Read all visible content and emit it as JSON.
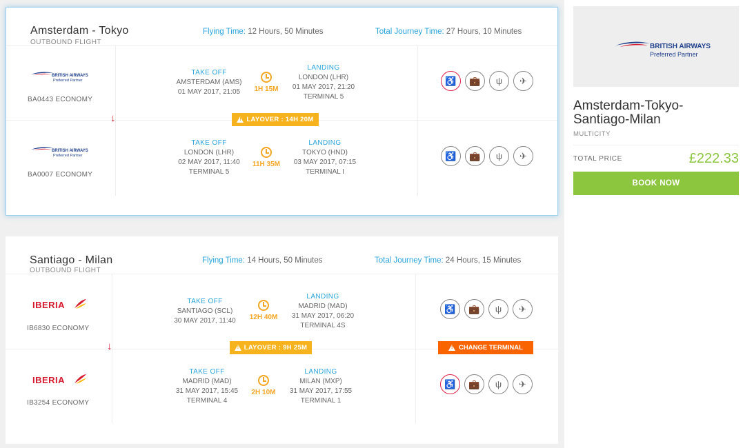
{
  "itineraries": [
    {
      "route": "Amsterdam - Tokyo",
      "subtitle": "OUTBOUND FLIGHT",
      "flying_label": "Flying Time:",
      "flying_value": " 12 Hours, 50 Minutes",
      "journey_label": "Total Journey Time:",
      "journey_value": " 27 Hours, 10 Minutes",
      "layover": "LAYOVER : 14H 20M",
      "segments": [
        {
          "airline": "BRITISH AIRWAYS",
          "airline_sub": "Preferred Partner",
          "code": "BA0443 ECONOMY",
          "takeoff_label": "TAKE OFF",
          "from": "AMSTERDAM (AMS)",
          "dep": "01 MAY 2017, 21:05",
          "duration": "1H 15M",
          "landing_label": "LANDING",
          "to": "LONDON (LHR)",
          "arr": "01 MAY 2017, 21:20",
          "terminal": "TERMINAL 5"
        },
        {
          "airline": "BRITISH AIRWAYS",
          "airline_sub": "Preferred Partner",
          "code": "BA0007 ECONOMY",
          "takeoff_label": "TAKE OFF",
          "from": "LONDON (LHR)",
          "dep": "02 MAY 2017, 11:40",
          "dep_terminal": "TERMINAL 5",
          "duration": "11H 35M",
          "landing_label": "LANDING",
          "to": "TOKYO (HND)",
          "arr": "03 MAY 2017, 07:15",
          "terminal": "TERMINAL I"
        }
      ]
    },
    {
      "route": "Santiago - Milan",
      "subtitle": "OUTBOUND FLIGHT",
      "flying_label": "Flying Time:",
      "flying_value": " 14 Hours, 50 Minutes",
      "journey_label": "Total Journey Time:",
      "journey_value": " 24 Hours, 15 Minutes",
      "layover": "LAYOVER : 9H 25M",
      "change_terminal": "CHANGE TERMINAL",
      "segments": [
        {
          "airline": "IBERIA",
          "code": "IB6830 ECONOMY",
          "takeoff_label": "TAKE OFF",
          "from": "SANTIAGO (SCL)",
          "dep": "30 MAY 2017, 11:40",
          "duration": "12H 40M",
          "landing_label": "LANDING",
          "to": "MADRID (MAD)",
          "arr": "31 MAY 2017, 06:20",
          "terminal": "TERMINAL 4S"
        },
        {
          "airline": "IBERIA",
          "code": "IB3254 ECONOMY",
          "takeoff_label": "TAKE OFF",
          "from": "MADRID (MAD)",
          "dep": "31 MAY 2017, 15:45",
          "dep_terminal": "TERMINAL 4",
          "duration": "2H 10M",
          "landing_label": "LANDING",
          "to": "MILAN (MXP)",
          "arr": "31 MAY 2017, 17:55",
          "terminal": "TERMINAL 1"
        }
      ]
    }
  ],
  "summary": {
    "airline": "BRITISH AIRWAYS",
    "airline_sub": "Preferred Partner",
    "title": "Amsterdam-Tokyo-Santiago-Milan",
    "type": "MULTICITY",
    "total_label": "TOTAL PRICE",
    "total_value": "£222.33",
    "book_label": "BOOK NOW"
  },
  "icons": [
    "seat-icon",
    "baggage-icon",
    "meal-icon",
    "plane-icon"
  ],
  "colors": {
    "accent_blue": "#27a3dd",
    "duration_orange": "#f5a623",
    "layover_yellow": "#f7b31e",
    "change_orange": "#fa6400",
    "book_green": "#8cc63f",
    "iberia_red": "#d7192d"
  }
}
